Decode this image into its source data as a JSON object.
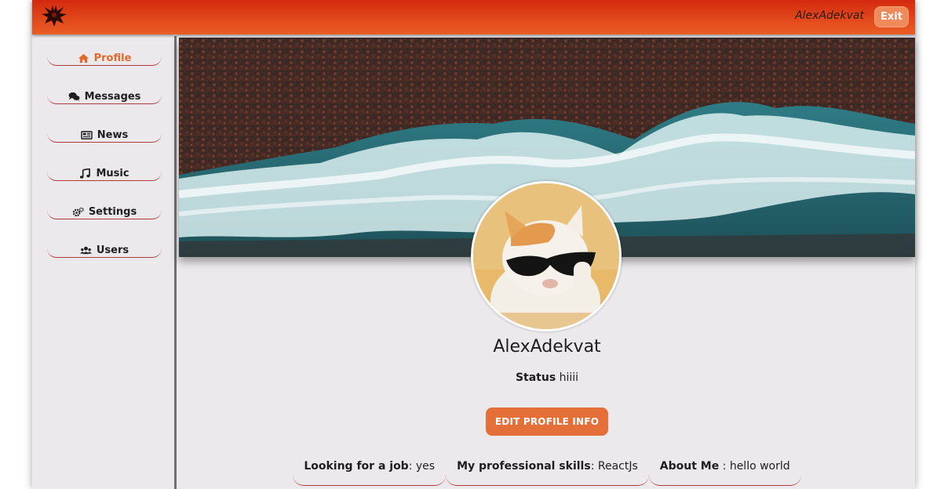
{
  "header": {
    "username": "AlexAdekvat",
    "exit_label": "Exit"
  },
  "sidebar": {
    "items": [
      {
        "label": "Profile",
        "icon": "home-icon",
        "active": true
      },
      {
        "label": "Messages",
        "icon": "comments-icon",
        "active": false
      },
      {
        "label": "News",
        "icon": "newspaper-icon",
        "active": false
      },
      {
        "label": "Music",
        "icon": "music-icon",
        "active": false
      },
      {
        "label": "Settings",
        "icon": "cogs-icon",
        "active": false
      },
      {
        "label": "Users",
        "icon": "users-icon",
        "active": false
      }
    ]
  },
  "profile": {
    "name": "AlexAdekvat",
    "status_label": "Status",
    "status_value": "hiiii",
    "edit_button": "EDIT PROFILE INFO",
    "info": [
      {
        "label": "Looking for a job",
        "value": ": yes"
      },
      {
        "label": "My professional skills",
        "value": ": ReactJs"
      },
      {
        "label": "About Me",
        "value": " : hello world"
      }
    ]
  },
  "colors": {
    "header_gradient_top": "#d32a10",
    "header_gradient_bottom": "#ea5d25",
    "accent": "#e56f38",
    "background": "#ece9ec"
  }
}
